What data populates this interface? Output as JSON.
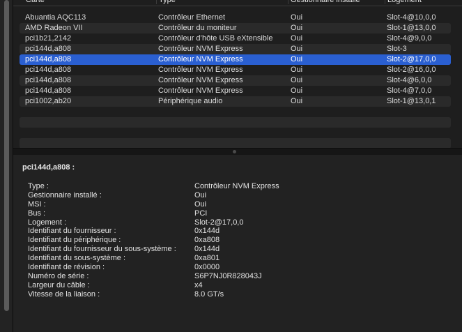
{
  "columns": {
    "carte": "Carte",
    "type": "Type",
    "gestionnaire": "Gestionnaire installé",
    "logement": "Logement"
  },
  "rows": [
    {
      "carte": "Abuantia AQC113",
      "type": "Contrôleur Ethernet",
      "gestionnaire": "Oui",
      "logement": "Slot-4@10,0,0"
    },
    {
      "carte": "AMD Radeon VII",
      "type": "Contrôleur du moniteur",
      "gestionnaire": "Oui",
      "logement": "Slot-1@13,0,0"
    },
    {
      "carte": "pci1b21,2142",
      "type": "Contrôleur d’hôte USB eXtensible",
      "gestionnaire": "Oui",
      "logement": "Slot-4@9,0,0"
    },
    {
      "carte": "pci144d,a808",
      "type": "Contrôleur NVM Express",
      "gestionnaire": "Oui",
      "logement": "Slot-3"
    },
    {
      "carte": "pci144d,a808",
      "type": "Contrôleur NVM Express",
      "gestionnaire": "Oui",
      "logement": "Slot-2@17,0,0"
    },
    {
      "carte": "pci144d,a808",
      "type": "Contrôleur NVM Express",
      "gestionnaire": "Oui",
      "logement": "Slot-2@16,0,0"
    },
    {
      "carte": "pci144d,a808",
      "type": "Contrôleur NVM Express",
      "gestionnaire": "Oui",
      "logement": "Slot-4@6,0,0"
    },
    {
      "carte": "pci144d,a808",
      "type": "Contrôleur NVM Express",
      "gestionnaire": "Oui",
      "logement": "Slot-4@7,0,0"
    },
    {
      "carte": "pci1002,ab20",
      "type": "Périphérique audio",
      "gestionnaire": "Oui",
      "logement": "Slot-1@13,0,1"
    }
  ],
  "selected_row": 4,
  "detail": {
    "title": "pci144d,a808 :",
    "properties": [
      {
        "key": "Type :",
        "value": "Contrôleur NVM Express"
      },
      {
        "key": "Gestionnaire installé :",
        "value": "Oui"
      },
      {
        "key": "MSI :",
        "value": "Oui"
      },
      {
        "key": "Bus :",
        "value": "PCI"
      },
      {
        "key": "Logement :",
        "value": "Slot-2@17,0,0"
      },
      {
        "key": "Identifiant du fournisseur :",
        "value": "0x144d"
      },
      {
        "key": "Identifiant du périphérique :",
        "value": "0xa808"
      },
      {
        "key": "Identifiant du fournisseur du sous-système :",
        "value": "0x144d"
      },
      {
        "key": "Identifiant du sous-système :",
        "value": "0xa801"
      },
      {
        "key": "Identifiant de révision :",
        "value": "0x0000"
      },
      {
        "key": "Numéro de série :",
        "value": "S6P7NJ0R828043J"
      },
      {
        "key": "Largeur du câble :",
        "value": "x4"
      },
      {
        "key": "Vitesse de la liaison :",
        "value": "8.0 GT/s"
      }
    ]
  },
  "colors": {
    "selection": "#2a5fd1",
    "background": "#1e1e1e"
  }
}
